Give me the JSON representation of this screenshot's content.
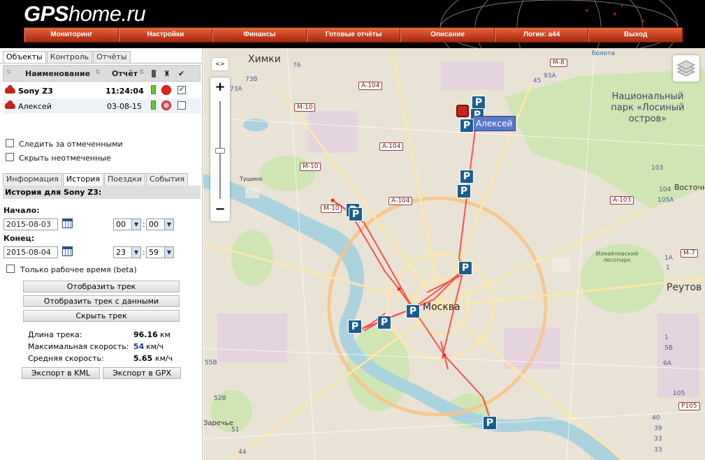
{
  "brand": {
    "logo_bold": "GPS",
    "logo_rest": "home.ru"
  },
  "nav": [
    "Мониторинг",
    "Настройки",
    "Финансы",
    "Готовые отчёты",
    "Описание",
    "Логин: a44",
    "Выход"
  ],
  "left_tabs": [
    "Объекты",
    "Контроль",
    "Отчёты"
  ],
  "objects_header": {
    "name": "Наименование",
    "report": "Отчёт"
  },
  "objects": [
    {
      "name": "Sony Z3",
      "report": "11:24:04",
      "status_color": "#e8201a",
      "checked": "✔"
    },
    {
      "name": "Алексей",
      "report": "03-08-15",
      "status_color": "#f0a0a0",
      "checked": ""
    }
  ],
  "options": {
    "follow": "Следить за отмеченными",
    "hide": "Скрыть неотмеченные"
  },
  "detail_tabs": [
    "Информация",
    "История",
    "Поездки",
    "События"
  ],
  "history": {
    "title": "История для Sony Z3:",
    "start_label": "Начало:",
    "start_date": "2015-08-03",
    "start_h": "00",
    "start_m": "00",
    "end_label": "Конец:",
    "end_date": "2015-08-04",
    "end_h": "23",
    "end_m": "59",
    "work_time": "Только рабочее время (beta)",
    "btn_show": "Отобразить трек",
    "btn_show_data": "Отобразить трек с данными",
    "btn_hide": "Скрыть трек"
  },
  "stats": {
    "length_label": "Длина трека:",
    "length_value": "96.16",
    "length_unit": "км",
    "maxspeed_label": "Максимальная скорость:",
    "maxspeed_value": "54",
    "maxspeed_unit": "км/ч",
    "avgspeed_label": "Средняя скорость:",
    "avgspeed_value": "5.65",
    "avgspeed_unit": "км/ч"
  },
  "export": {
    "kml": "Экспорт в KML",
    "gpx": "Экспорт в GPX"
  },
  "map": {
    "labels": {
      "khimki": "Химки",
      "moscow": "Москва",
      "park": "Национальный парк «Лосиный остров»",
      "izmaylovo": "Измайловский лесопарк",
      "reutov": "Реутов",
      "vostoch": "Восточн",
      "tushino": "Тушино",
      "zarechye": "Заречье",
      "bolota": "болота"
    },
    "highways": [
      "A-104",
      "A-104",
      "A-104",
      "M-10",
      "M-10",
      "M-8",
      "A-103",
      "M-7",
      "Р105",
      "M-10"
    ],
    "marker_label": "Алексей",
    "collapse": "<>",
    "zoom_in": "+",
    "zoom_out": "−",
    "parking": "P",
    "numbers": [
      "76",
      "73B",
      "73A",
      "93A",
      "45",
      "103",
      "104",
      "105A",
      "1A",
      "1",
      "1",
      "5B",
      "6A",
      "105",
      "55B",
      "52B",
      "51",
      "44",
      "40",
      "39",
      "33",
      "33"
    ]
  },
  "colors": {
    "track": "#ff2020",
    "nav": "#c3401e",
    "parking": "#1a5e90"
  }
}
